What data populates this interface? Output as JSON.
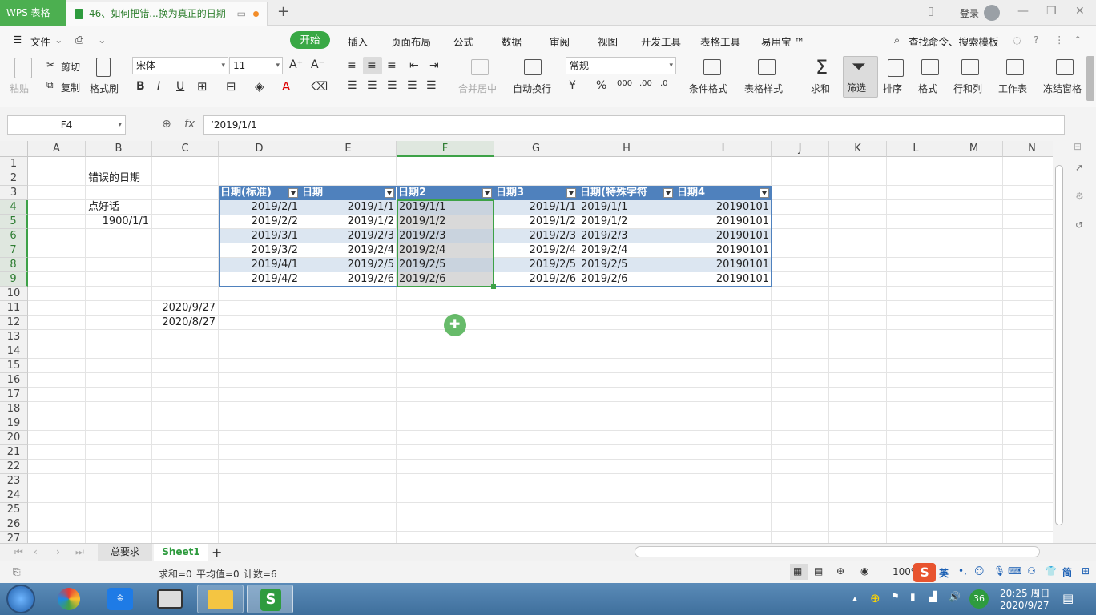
{
  "titlebar": {
    "app_name": "WPS 表格",
    "doc_tab": "46、如何把错...换为真正的日期",
    "new_tab": "+",
    "login": "登录"
  },
  "menu": {
    "file": "文件",
    "items": [
      "开始",
      "插入",
      "页面布局",
      "公式",
      "数据",
      "审阅",
      "视图",
      "开发工具",
      "表格工具",
      "易用宝 ™"
    ],
    "search": "查找命令、搜索模板"
  },
  "ribbon": {
    "paste": "粘贴",
    "cut": "剪切",
    "copy": "复制",
    "format_painter": "格式刷",
    "font_name": "宋体",
    "font_size": "11",
    "merge": "合并居中",
    "wrap": "自动换行",
    "number_format": "常规",
    "cond_format": "条件格式",
    "table_style": "表格样式",
    "sum": "求和",
    "filter": "筛选",
    "sort": "排序",
    "format": "格式",
    "row_col": "行和列",
    "worksheet": "工作表",
    "freeze": "冻结窗格"
  },
  "formula_bar": {
    "name_box": "F4",
    "fx": "fx",
    "content": "’2019/1/1"
  },
  "columns": [
    "A",
    "B",
    "C",
    "D",
    "E",
    "F",
    "G",
    "H",
    "I",
    "J",
    "K",
    "L",
    "M",
    "N"
  ],
  "rows": [
    "1",
    "2",
    "3",
    "4",
    "5",
    "6",
    "7",
    "8",
    "9",
    "10",
    "11",
    "12",
    "13",
    "14",
    "15",
    "16",
    "17",
    "18",
    "19",
    "20",
    "21",
    "22",
    "23",
    "24",
    "25",
    "26",
    "27"
  ],
  "cells": {
    "B2": "错误的日期",
    "B4": "点好话",
    "B5": "1900/1/1",
    "C11": "2020/9/27",
    "C12": "2020/8/27"
  },
  "table": {
    "headers": [
      "日期(标准)",
      "日期",
      "日期2",
      "日期3",
      "日期(特殊字符",
      "日期4"
    ],
    "rows": [
      [
        "2019/2/1",
        "2019/1/1",
        "2019/1/1",
        "2019/1/1",
        "2019/1/1",
        "20190101"
      ],
      [
        "2019/2/2",
        "2019/1/2",
        "2019/1/2",
        "2019/1/2",
        "2019/1/2",
        "20190101"
      ],
      [
        "2019/3/1",
        "2019/2/3",
        "2019/2/3",
        "2019/2/3",
        "2019/2/3",
        "20190101"
      ],
      [
        "2019/3/2",
        "2019/2/4",
        "2019/2/4",
        "2019/2/4",
        "2019/2/4",
        "20190101"
      ],
      [
        "2019/4/1",
        "2019/2/5",
        "2019/2/5",
        "2019/2/5",
        "2019/2/5",
        "20190101"
      ],
      [
        "2019/4/2",
        "2019/2/6",
        "2019/2/6",
        "2019/2/6",
        "2019/2/6",
        "20190101"
      ]
    ]
  },
  "sheets": {
    "tabs": [
      "总要求",
      "Sheet1"
    ],
    "active": "Sheet1",
    "add": "+"
  },
  "status": {
    "sum": "求和=0",
    "avg": "平均值=0",
    "count": "计数=6",
    "zoom": "100%"
  },
  "taskbar": {
    "time": "20:25 周日",
    "date": "2020/9/27",
    "badge": "36",
    "ime": "英"
  },
  "colors": {
    "accent": "#39a845",
    "table_header": "#4f81bd",
    "table_band": "#dce6f1"
  }
}
